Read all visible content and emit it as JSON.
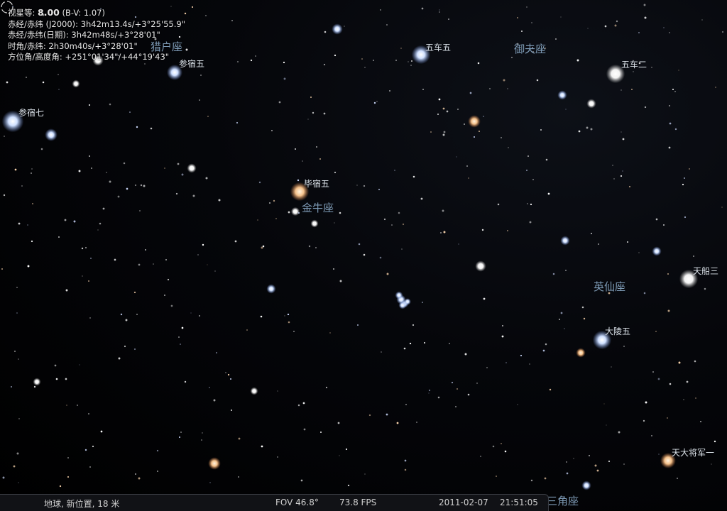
{
  "info": {
    "mag_label": "视星等: ",
    "mag_value": "8.00",
    "mag_bv": " (B-V: 1.07)",
    "radec_j2000": "赤经/赤纬 (J2000): 3h42m13.4s/+3°25'55.9\"",
    "radec_date": "赤经/赤纬(日期): 3h42m48s/+3°28'01\"",
    "hourangle": "时角/赤纬: 2h30m40s/+3°28'01\"",
    "azalt": "方位角/高度角: +251°01'34\"/+44°19'43\""
  },
  "star_labels": {
    "shenxiu5": "参宿五",
    "shenxiu7": "参宿七",
    "wuche5": "五车五",
    "wuche2": "五车二",
    "bixiu5": "毕宿五",
    "tianchuan3": "天船三",
    "daling5": "大陵五",
    "tiandajiangjun1": "天大将军一"
  },
  "constellations": {
    "orion": "猎户座",
    "auriga": "御夫座",
    "taurus": "金牛座",
    "perseus": "英仙座",
    "triangulum": "三角座"
  },
  "status": {
    "location": "地球, 新位置, 18 米",
    "fov": "FOV 46.8°",
    "fps": "73.8 FPS",
    "date": "2011-02-07",
    "time": "21:51:05"
  },
  "icons": {
    "reticle": "selection-reticle-icon"
  }
}
